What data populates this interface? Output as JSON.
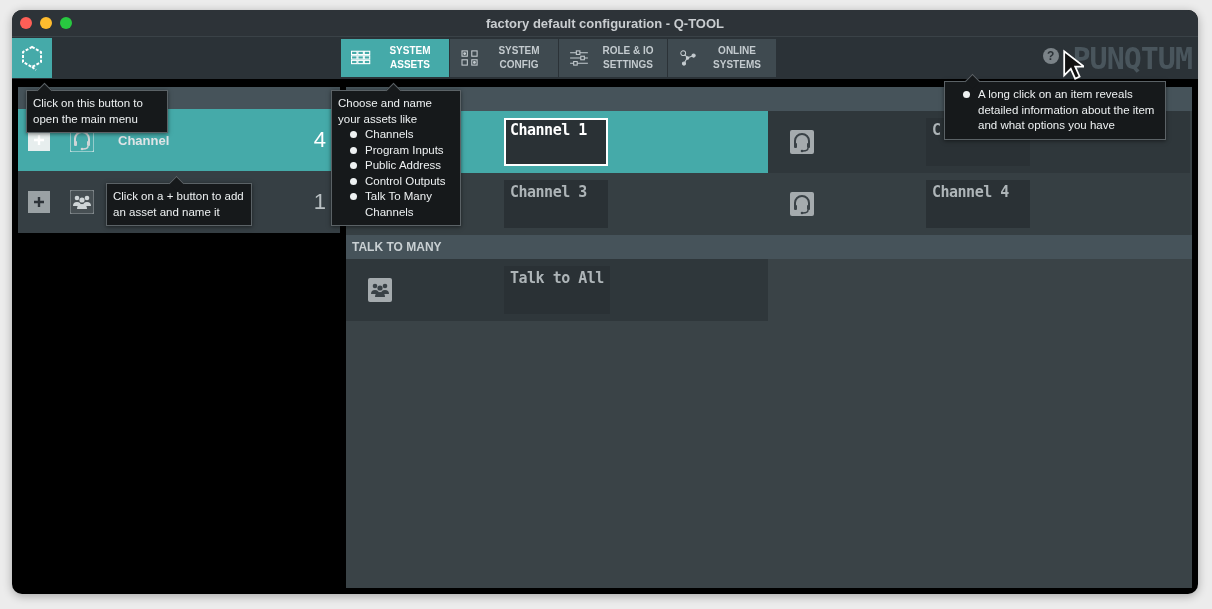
{
  "window": {
    "title": "factory default configuration - Q-TOOL"
  },
  "tabs": [
    {
      "lines": [
        "SYSTEM",
        "ASSETS"
      ],
      "kind": "grid",
      "selected": true
    },
    {
      "lines": [
        "SYSTEM",
        "CONFIG"
      ],
      "kind": "squares",
      "selected": false
    },
    {
      "lines": [
        "ROLE & IO",
        "SETTINGS"
      ],
      "kind": "sliders",
      "selected": false
    },
    {
      "lines": [
        "ONLINE",
        "SYSTEMS"
      ],
      "kind": "nodes",
      "selected": false
    }
  ],
  "help": {
    "glyph": "?"
  },
  "brand": "PUNQTUM",
  "asset_types": [
    {
      "kind": "headset",
      "label": "Channel",
      "count": "4",
      "selected": true
    },
    {
      "kind": "group",
      "count": "1",
      "selected": false
    }
  ],
  "sections": [
    {
      "items": [
        {
          "name": "Channel 1",
          "selected": true
        },
        {
          "kind": "headset",
          "name": "C",
          "selected": false
        },
        {
          "name": "Channel 3",
          "selected": false
        },
        {
          "kind": "headset",
          "name": "Channel 4",
          "selected": false
        }
      ]
    },
    {
      "title": "TALK TO MANY",
      "items": [
        {
          "kind": "group",
          "name": "Talk to All",
          "selected": false
        }
      ]
    }
  ],
  "tooltips": [
    {
      "text": "Click on this button to open the main menu"
    },
    {
      "text": "Choose and name your assets like",
      "bullets": [
        "Channels",
        "Program Inputs",
        "Public Address",
        "Control Outputs",
        "Talk To Many Channels"
      ]
    },
    {
      "bullets": [
        "A long click on an item reveals detailed information about the item and what options you have"
      ]
    },
    {
      "text": "Click on a + button to add an asset and name it"
    }
  ]
}
